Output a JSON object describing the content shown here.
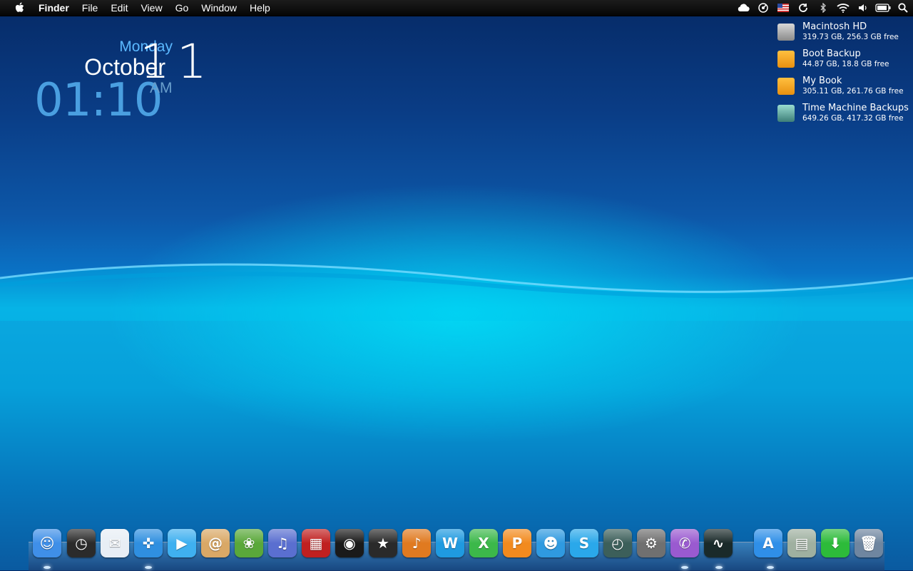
{
  "menubar": {
    "items": [
      "Finder",
      "File",
      "Edit",
      "View",
      "Go",
      "Window",
      "Help"
    ],
    "status_icons": [
      "cloud-icon",
      "radar-icon",
      "us-flag-icon",
      "sync-icon",
      "bluetooth-icon",
      "wifi-icon",
      "volume-icon",
      "battery-icon",
      "spotlight-search-icon"
    ]
  },
  "clock": {
    "day": "Monday",
    "month": "October",
    "date": "11",
    "time": "01:10",
    "ampm": "AM"
  },
  "disks": [
    {
      "name": "Macintosh HD",
      "info": "319.73 GB, 256.3 GB free",
      "icon": "hard-drive-icon",
      "color": "#9a9a9a"
    },
    {
      "name": "Boot Backup",
      "info": "44.87 GB, 18.8 GB free",
      "icon": "external-drive-icon",
      "color": "#f2a623"
    },
    {
      "name": "My Book",
      "info": "305.11 GB, 261.76 GB free",
      "icon": "external-drive-icon",
      "color": "#f2a623"
    },
    {
      "name": "Time Machine Backups",
      "info": "649.26 GB, 417.32 GB free",
      "icon": "time-machine-drive-icon",
      "color": "#4f9a8f"
    }
  ],
  "dock": [
    {
      "name": "finder-icon",
      "color": "#3f8fe8",
      "glyph": "☺"
    },
    {
      "name": "dashboard-icon",
      "color": "#2b2b2b",
      "glyph": "◷"
    },
    {
      "name": "mail-icon",
      "color": "#e8eef5",
      "glyph": "✉"
    },
    {
      "name": "safari-icon",
      "color": "#2f8fe0",
      "glyph": "✜"
    },
    {
      "name": "facetime-icon",
      "color": "#3fb0f0",
      "glyph": "▶"
    },
    {
      "name": "address-book-icon",
      "color": "#d9a866",
      "glyph": "@"
    },
    {
      "name": "iphoto-icon",
      "color": "#5aa83a",
      "glyph": "❀"
    },
    {
      "name": "itunes-icon",
      "color": "#5a6fd0",
      "glyph": "♫"
    },
    {
      "name": "photo-booth-icon",
      "color": "#c02020",
      "glyph": "▦"
    },
    {
      "name": "aperture-icon",
      "color": "#1a1a1a",
      "glyph": "◉"
    },
    {
      "name": "imovie-icon",
      "color": "#2a2a2a",
      "glyph": "★"
    },
    {
      "name": "garageband-icon",
      "color": "#e07a20",
      "glyph": "♪"
    },
    {
      "name": "word-icon",
      "color": "#1f9ae0",
      "glyph": "W"
    },
    {
      "name": "excel-icon",
      "color": "#3cb84a",
      "glyph": "X"
    },
    {
      "name": "powerpoint-icon",
      "color": "#f28a1e",
      "glyph": "P"
    },
    {
      "name": "messenger-icon",
      "color": "#2f9ae0",
      "glyph": "☻"
    },
    {
      "name": "skype-icon",
      "color": "#2aa8ea",
      "glyph": "S"
    },
    {
      "name": "time-machine-icon",
      "color": "#3c5f5a",
      "glyph": "◴"
    },
    {
      "name": "system-preferences-icon",
      "color": "#707070",
      "glyph": "⚙"
    },
    {
      "name": "ichat-icon",
      "color": "#9a5ad0",
      "glyph": "✆"
    },
    {
      "name": "activity-monitor-icon",
      "color": "#1a2a2a",
      "glyph": "∿"
    },
    {
      "name": "app-store-icon",
      "color": "#2f8fe8",
      "glyph": "A"
    },
    {
      "name": "documents-stack-icon",
      "color": "#9fb0a0",
      "glyph": "▤"
    },
    {
      "name": "downloads-stack-icon",
      "color": "#2dbb3a",
      "glyph": "⬇"
    },
    {
      "name": "trash-icon",
      "color": "#6f86a0",
      "glyph": "🗑"
    }
  ]
}
